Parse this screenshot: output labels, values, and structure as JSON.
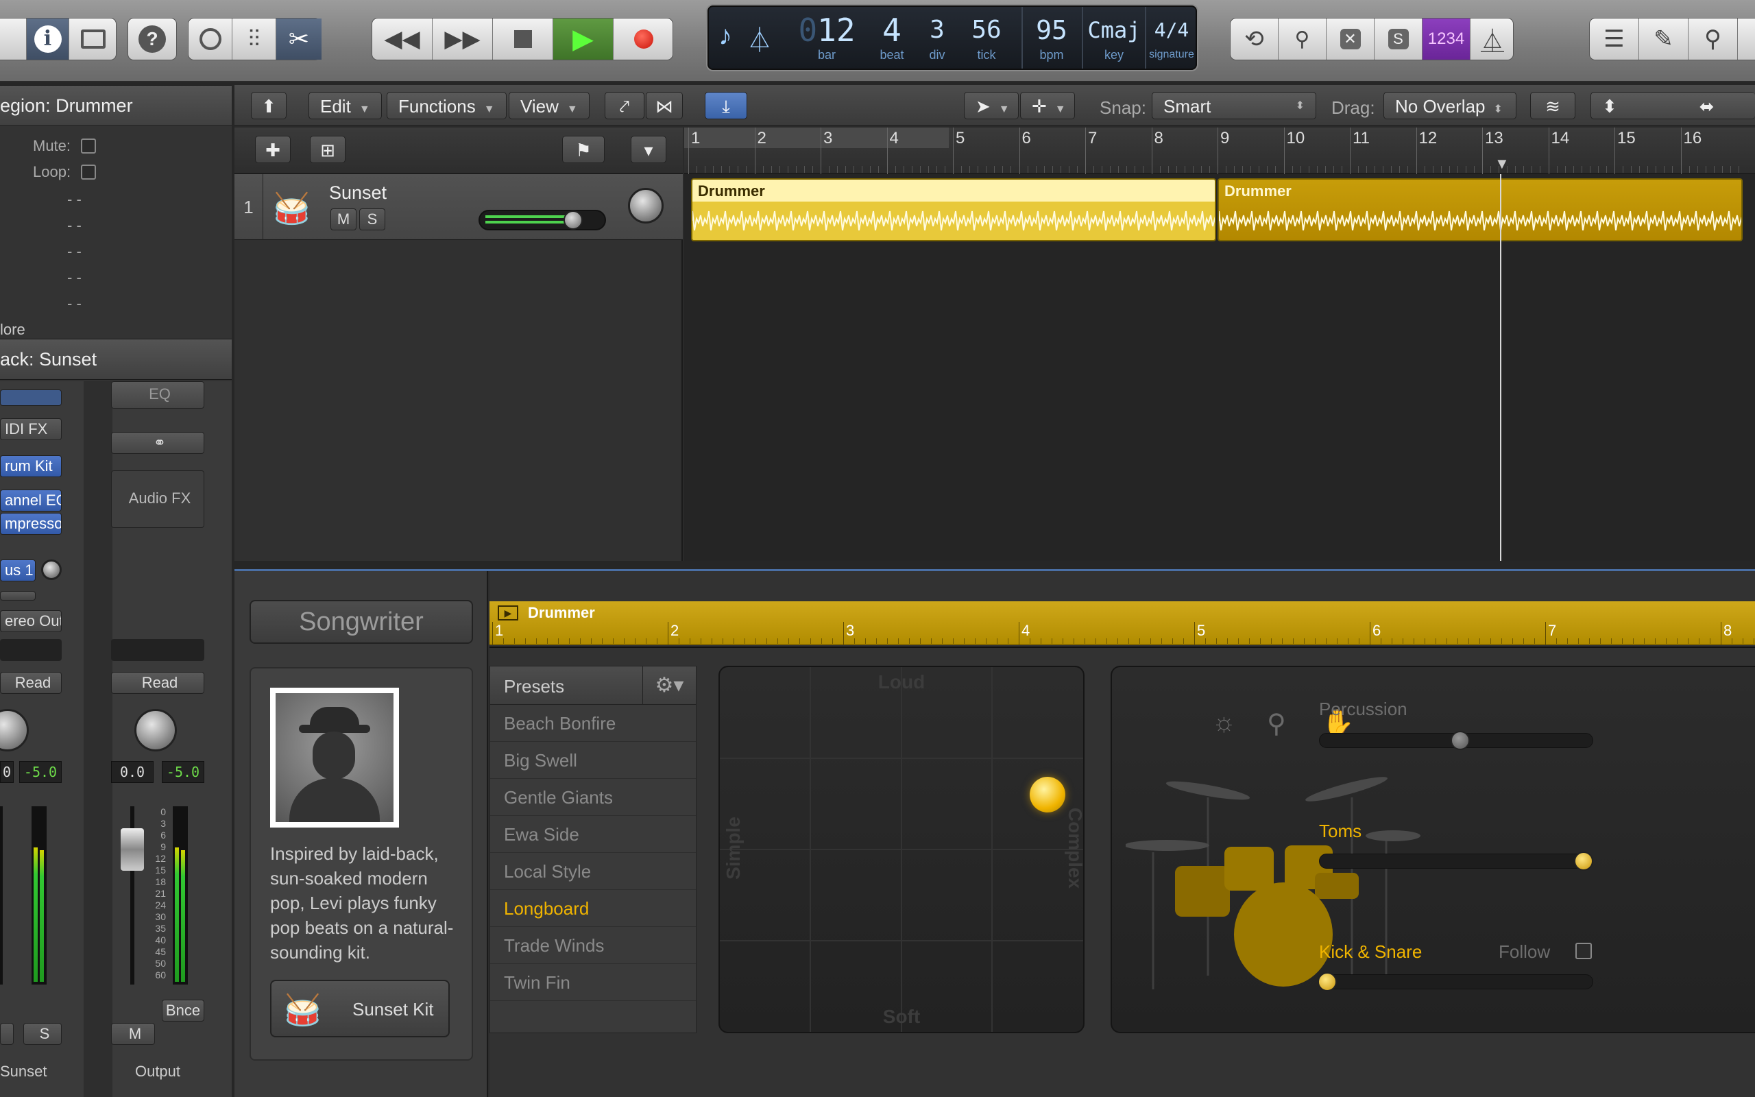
{
  "control_bar": {
    "lcd": {
      "bar": "12",
      "bar_lead": "0",
      "bar_label": "bar",
      "beat": "4",
      "beat_label": "beat",
      "div": "3",
      "div_label": "div",
      "tick": "56",
      "tick_label": "tick",
      "bpm": "95",
      "bpm_label": "bpm",
      "key": "Cmaj",
      "key_label": "key",
      "sig_num": "4",
      "sig_den": "4",
      "sig_label": "signature"
    },
    "solo_label": "S",
    "countin_label": "1234"
  },
  "inspector": {
    "region_header": "egion: Drummer",
    "mute_label": "Mute:",
    "loop_label": "Loop:",
    "dashes": "- -",
    "more_label": "lore",
    "track_header": "ack:  Sunset",
    "strip1": {
      "midi_fx": "IDI FX",
      "instrument": "rum Kit",
      "eq": "annel EQ",
      "comp": "mpressor",
      "bus": "us 1",
      "output": "ereo Out",
      "read": "Read",
      "val1": "0",
      "val2": "-5.0",
      "solo": "S",
      "name": "Sunset"
    },
    "strip2": {
      "eq": "EQ",
      "audio_fx": "Audio FX",
      "read": "Read",
      "val1": "0.0",
      "val2": "-5.0",
      "mute": "M",
      "bounce": "Bnce",
      "name": "Output"
    },
    "meter_scale": [
      "0",
      "3",
      "6",
      "9",
      "12",
      "15",
      "18",
      "21",
      "24",
      "30",
      "35",
      "40",
      "45",
      "50",
      "60"
    ]
  },
  "tracks": {
    "menus": {
      "edit": "Edit",
      "functions": "Functions",
      "view": "View"
    },
    "snap_label": "Snap:",
    "snap_value": "Smart",
    "drag_label": "Drag:",
    "drag_value": "No Overlap",
    "ruler": [
      "1",
      "2",
      "3",
      "4",
      "5",
      "6",
      "7",
      "8",
      "9",
      "10",
      "11",
      "12",
      "13",
      "14",
      "15",
      "16"
    ],
    "track": {
      "number": "1",
      "name": "Sunset",
      "mute": "M",
      "solo": "S"
    },
    "regions": [
      {
        "name": "Drummer"
      },
      {
        "name": "Drummer"
      }
    ]
  },
  "editor": {
    "library_title": "Songwriter",
    "drummer_desc": "Inspired by laid-back, sun-soaked modern pop, Levi plays funky pop beats on a natural-sounding kit.",
    "kit_button": "Sunset Kit",
    "region_name": "Drummer",
    "ruler": [
      "1",
      "2",
      "3",
      "4",
      "5",
      "6",
      "7",
      "8"
    ],
    "presets_label": "Presets",
    "presets": [
      "Beach Bonfire",
      "Big Swell",
      "Gentle Giants",
      "Ewa Side",
      "Local Style",
      "Longboard",
      "Trade Winds",
      "Twin Fin"
    ],
    "selected_preset": "Longboard",
    "xy": {
      "top": "Loud",
      "bottom": "Soft",
      "left": "Simple",
      "right": "Complex"
    },
    "kit": {
      "percussion": "Percussion",
      "toms": "Toms",
      "kick_snare": "Kick & Snare",
      "follow": "Follow"
    },
    "accent": "#f0b400"
  }
}
